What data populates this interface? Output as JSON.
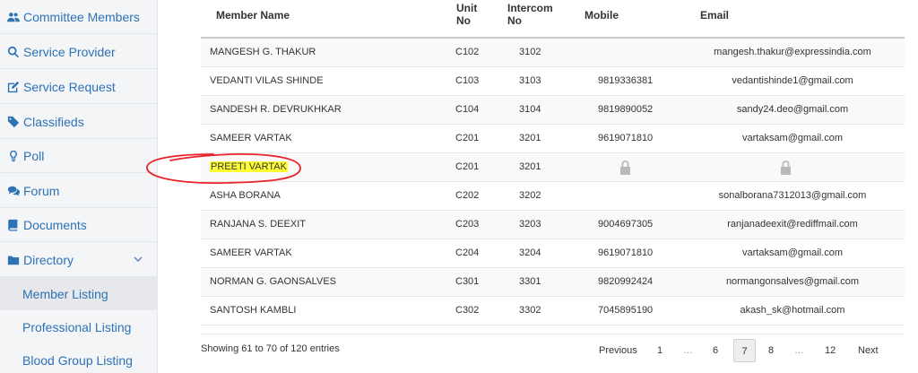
{
  "sidebar": {
    "items": [
      {
        "label": "Committee Members",
        "icon": "users-icon"
      },
      {
        "label": "Service Provider",
        "icon": "search-icon"
      },
      {
        "label": "Service Request",
        "icon": "edit-icon"
      },
      {
        "label": "Classifieds",
        "icon": "tags-icon"
      },
      {
        "label": "Poll",
        "icon": "lightbulb-icon"
      },
      {
        "label": "Forum",
        "icon": "comments-icon"
      },
      {
        "label": "Documents",
        "icon": "book-icon"
      },
      {
        "label": "Directory",
        "icon": "folder-icon",
        "expanded": true
      }
    ],
    "subitems": [
      {
        "label": "Member Listing",
        "active": true
      },
      {
        "label": "Professional Listing"
      },
      {
        "label": "Blood Group Listing"
      }
    ]
  },
  "table": {
    "headers": {
      "name": "Member Name",
      "unit_line1": "Unit",
      "unit_line2": "No",
      "intercom_line1": "Intercom",
      "intercom_line2": "No",
      "mobile": "Mobile",
      "email": "Email"
    },
    "rows": [
      {
        "name": "MANGESH G. THAKUR",
        "unit": "C102",
        "intercom": "3102",
        "mobile": "",
        "email": "mangesh.thakur@expressindia.com"
      },
      {
        "name": "VEDANTI VILAS SHINDE",
        "unit": "C103",
        "intercom": "3103",
        "mobile": "9819336381",
        "email": "vedantishinde1@gmail.com"
      },
      {
        "name": "SANDESH R. DEVRUKHKAR",
        "unit": "C104",
        "intercom": "3104",
        "mobile": "9819890052",
        "email": "sandy24.deo@gmail.com"
      },
      {
        "name": "SAMEER VARTAK",
        "unit": "C201",
        "intercom": "3201",
        "mobile": "9619071810",
        "email": "vartaksam@gmail.com"
      },
      {
        "name": "PREETI VARTAK",
        "unit": "C201",
        "intercom": "3201",
        "mobile": "",
        "email": "",
        "locked": true,
        "highlighted": true
      },
      {
        "name": "ASHA BORANA",
        "unit": "C202",
        "intercom": "3202",
        "mobile": "",
        "email": "sonalborana7312013@gmail.com"
      },
      {
        "name": "RANJANA S. DEEXIT",
        "unit": "C203",
        "intercom": "3203",
        "mobile": "9004697305",
        "email": "ranjanadeexit@rediffmail.com"
      },
      {
        "name": "SAMEER VARTAK",
        "unit": "C204",
        "intercom": "3204",
        "mobile": "9619071810",
        "email": "vartaksam@gmail.com"
      },
      {
        "name": "NORMAN G. GAONSALVES",
        "unit": "C301",
        "intercom": "3301",
        "mobile": "9820992424",
        "email": "normangonsalves@gmail.com"
      },
      {
        "name": "SANTOSH KAMBLI",
        "unit": "C302",
        "intercom": "3302",
        "mobile": "7045895190",
        "email": "akash_sk@hotmail.com"
      }
    ]
  },
  "footer": {
    "info": "Showing 61 to 70 of 120 entries",
    "pagination": [
      "Previous",
      "1",
      "…",
      "6",
      "7",
      "8",
      "…",
      "12",
      "Next"
    ],
    "current_page": "7"
  },
  "colors": {
    "link": "#2d72b5",
    "highlight": "#ffff33",
    "annotation": "#e8232a",
    "lock": "#b9b9b9"
  }
}
